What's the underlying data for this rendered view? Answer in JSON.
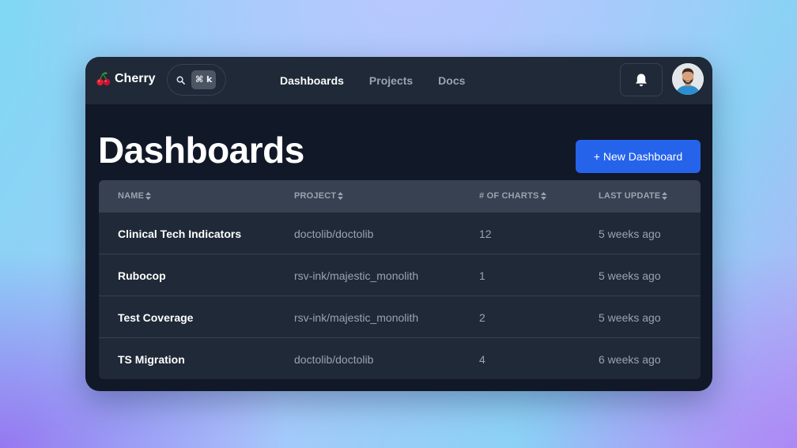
{
  "brand": {
    "name": "Cherry",
    "icon": "cherry-icon"
  },
  "search": {
    "icon": "search-icon",
    "shortcut": "⌘ k"
  },
  "nav": [
    {
      "label": "Dashboards",
      "active": true
    },
    {
      "label": "Projects",
      "active": false
    },
    {
      "label": "Docs",
      "active": false
    }
  ],
  "header_actions": {
    "notification_icon": "bell-icon",
    "avatar": "user-avatar"
  },
  "page": {
    "title": "Dashboards",
    "new_button_label": "+ New Dashboard"
  },
  "table": {
    "columns": [
      "NAME",
      "PROJECT",
      "# OF CHARTS",
      "LAST UPDATE"
    ],
    "rows": [
      [
        "Clinical Tech Indicators",
        "doctolib/doctolib",
        "12",
        "5 weeks ago"
      ],
      [
        "Rubocop",
        "rsv-ink/majestic_monolith",
        "1",
        "5 weeks ago"
      ],
      [
        "Test Coverage",
        "rsv-ink/majestic_monolith",
        "2",
        "5 weeks ago"
      ],
      [
        "TS Migration",
        "doctolib/doctolib",
        "4",
        "6 weeks ago"
      ]
    ]
  },
  "colors": {
    "window_bg": "#111827",
    "navbar_bg": "#1f2937",
    "table_header_bg": "#374151",
    "primary_button": "#2563eb",
    "muted_text": "#9ca3af"
  }
}
